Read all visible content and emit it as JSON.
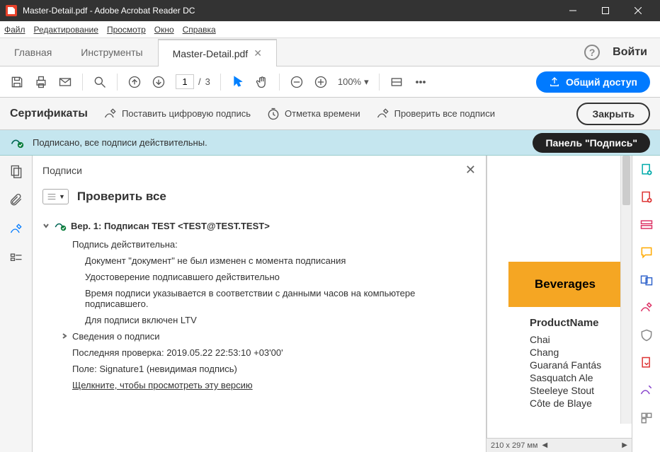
{
  "window": {
    "title": "Master-Detail.pdf - Adobe Acrobat Reader DC"
  },
  "menu": {
    "file": "Файл",
    "edit": "Редактирование",
    "view": "Просмотр",
    "window": "Окно",
    "help": "Справка"
  },
  "tabs": {
    "home": "Главная",
    "tools": "Инструменты",
    "doc": "Master-Detail.pdf",
    "login": "Войти"
  },
  "toolbar": {
    "page_current": "1",
    "page_sep": "/",
    "page_total": "3",
    "zoom": "100%",
    "share": "Общий доступ"
  },
  "certs": {
    "title": "Сертификаты",
    "sign": "Поставить цифровую подпись",
    "timestamp": "Отметка времени",
    "verify_all": "Проверить все подписи",
    "close": "Закрыть"
  },
  "signed": {
    "msg": "Подписано, все подписи действительны.",
    "panel": "Панель \"Подпись\""
  },
  "sigpanel": {
    "title": "Подписи",
    "verify": "Проверить все",
    "version": "Вер. 1: Подписан TEST <TEST@TEST.TEST>",
    "valid": "Подпись действительна:",
    "d1": "Документ \"документ\" не был изменен с момента подписания",
    "d2": "Удостоверение подписавшего действительно",
    "d3": "Время подписи указывается в соответствии с данными часов на компьютере подписавшего.",
    "d4": "Для подписи включен LTV",
    "details": "Сведения о подписи",
    "lastcheck": "Последняя проверка: 2019.05.22 22:53:10 +03'00'",
    "field": "Поле: Signature1 (невидимая подпись)",
    "click": "Щелкните, чтобы просмотреть эту версию"
  },
  "doc": {
    "category": "Beverages",
    "col": "ProductName",
    "rows": [
      "Chai",
      "Chang",
      "Guaraná Fantás",
      "Sasquatch Ale",
      "Steeleye Stout",
      "Côte de Blaye"
    ],
    "size": "210 x 297 мм"
  }
}
